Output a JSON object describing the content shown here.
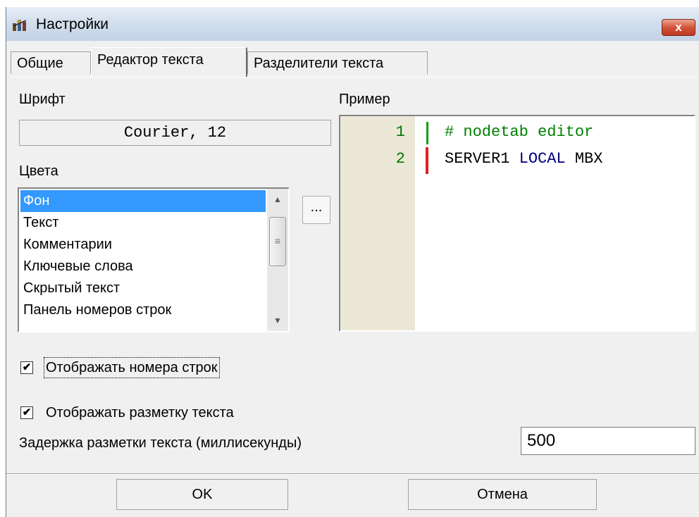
{
  "window": {
    "title": "Настройки",
    "close_label": "x"
  },
  "tabs": [
    {
      "label": "Общие",
      "active": false
    },
    {
      "label": "Редактор текста",
      "active": true
    },
    {
      "label": "Разделители текста",
      "active": false
    }
  ],
  "font_section": {
    "label": "Шрифт",
    "value": "Courier, 12"
  },
  "colors_section": {
    "label": "Цвета",
    "items": [
      "Фон",
      "Текст",
      "Комментарии",
      "Ключевые слова",
      "Скрытый текст",
      "Панель номеров строк"
    ],
    "selected_index": 0,
    "ellipsis_label": "..."
  },
  "preview": {
    "label": "Пример",
    "line_numbers": [
      "1",
      "2"
    ],
    "line1": "# nodetab editor",
    "line2_part1": "SERVER1 ",
    "line2_keyword": "LOCAL",
    "line2_part2": " MBX",
    "colors": {
      "comment": "#008000",
      "keyword": "#000080",
      "gutter": "#ebe8d8"
    }
  },
  "options": {
    "show_line_numbers": {
      "label": "Отображать номера строк",
      "checked": true
    },
    "show_markup": {
      "label": "Отображать разметку текста",
      "checked": true
    },
    "delay_label": "Задержка разметки текста (миллисекунды)",
    "delay_value": "500"
  },
  "buttons": {
    "ok": "OK",
    "cancel": "Отмена"
  },
  "icons": {
    "check": "✔",
    "scroll_up": "▲",
    "scroll_down": "▼",
    "grip": "≡"
  }
}
